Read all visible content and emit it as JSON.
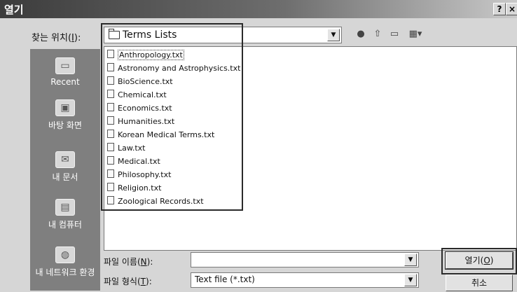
{
  "window": {
    "title": "열기",
    "help_button": "?",
    "close_button": "×"
  },
  "look_in": {
    "label": "찾는 위치(I):",
    "label_prefix": "찾는 위치(",
    "label_key": "I",
    "label_suffix": "):",
    "value": "Terms Lists"
  },
  "places": [
    {
      "label": "Recent",
      "icon": "recent-folder-icon"
    },
    {
      "label": "바탕 화면",
      "icon": "desktop-icon"
    },
    {
      "label": "내 문서",
      "icon": "my-documents-icon"
    },
    {
      "label": "내 컴퓨터",
      "icon": "my-computer-icon"
    },
    {
      "label": "내 네트워크 환경",
      "icon": "network-icon"
    }
  ],
  "files": [
    "Anthropology.txt",
    "Astronomy and Astrophysics.txt",
    "BioScience.txt",
    "Chemical.txt",
    "Economics.txt",
    "Humanities.txt",
    "Korean Medical Terms.txt",
    "Law.txt",
    "Medical.txt",
    "Philosophy.txt",
    "Religion.txt",
    "Zoological Records.txt"
  ],
  "file_name": {
    "label_prefix": "파일 이름(",
    "label_key": "N",
    "label_suffix": "):",
    "value": ""
  },
  "file_type": {
    "label_prefix": "파일 형식(",
    "label_key": "T",
    "label_suffix": "):",
    "value": "Text file  (*.txt)"
  },
  "buttons": {
    "open_prefix": "열기(",
    "open_key": "O",
    "open_suffix": ")",
    "cancel": "취소"
  }
}
